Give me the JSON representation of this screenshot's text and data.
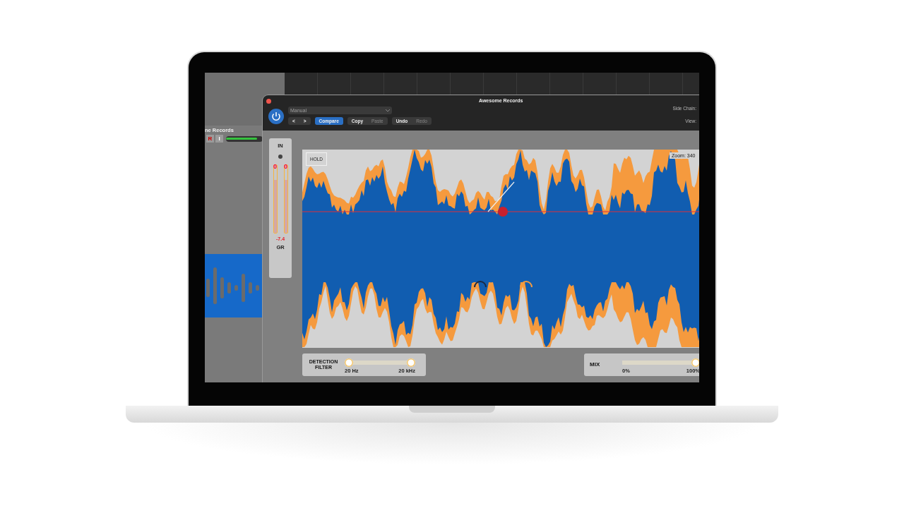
{
  "daw": {
    "track": {
      "name": "ne Records",
      "record": "R",
      "input": "I",
      "fader": {
        "level": 0.85
      }
    }
  },
  "plugin": {
    "title": "Awesome Records",
    "preset": "Manual",
    "toolbar_groups": [
      {
        "buttons": [
          {
            "label": "<",
            "selected": false,
            "disabled": false
          },
          {
            "label": ">",
            "selected": false,
            "disabled": false
          }
        ]
      },
      {
        "buttons": [
          {
            "label": "Compare",
            "selected": true,
            "disabled": false
          }
        ]
      },
      {
        "buttons": [
          {
            "label": "Copy",
            "selected": false,
            "disabled": false
          },
          {
            "label": "Paste",
            "selected": false,
            "disabled": true
          }
        ]
      },
      {
        "buttons": [
          {
            "label": "Undo",
            "selected": false,
            "disabled": false
          },
          {
            "label": "Redo",
            "selected": false,
            "disabled": true
          }
        ]
      }
    ],
    "side_chain_label": "Side Chain:",
    "view_label": "View:",
    "meter": {
      "label": "IN",
      "channels": [
        {
          "peak": "0",
          "level": 0.78
        },
        {
          "peak": "0",
          "level": 0.78
        }
      ],
      "gr_value": "-7.4",
      "gr_label": "GR"
    },
    "display": {
      "hold": "HOLD",
      "zoom": "Zoom: 340"
    },
    "detection_filter": {
      "label": "DETECTION FILTER",
      "min_label": "20 Hz",
      "max_label": "20 kHz",
      "low": {
        "level": 0
      },
      "high": {
        "level": 1
      }
    },
    "mix": {
      "label": "MIX",
      "min_label": "0%",
      "max_label": "100%",
      "level": 1
    }
  }
}
